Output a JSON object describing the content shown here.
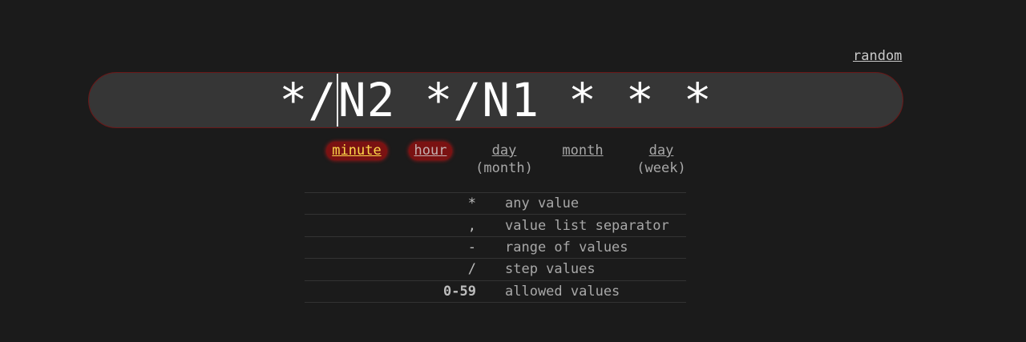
{
  "header": {
    "random_label": "random"
  },
  "cron": {
    "before_caret": "*/",
    "after_caret": "N2 */N1 * * *"
  },
  "fields": [
    {
      "name": "minute",
      "sub": "",
      "state": "active-primary"
    },
    {
      "name": "hour",
      "sub": "",
      "state": "active-secondary"
    },
    {
      "name": "day",
      "sub": "(month)",
      "state": "normal"
    },
    {
      "name": "month",
      "sub": "",
      "state": "normal"
    },
    {
      "name": "day",
      "sub": "(week)",
      "state": "normal"
    }
  ],
  "legend": [
    {
      "symbol": "*",
      "description": "any value"
    },
    {
      "symbol": ",",
      "description": "value list separator"
    },
    {
      "symbol": "-",
      "description": "range of values"
    },
    {
      "symbol": "/",
      "description": "step values"
    },
    {
      "symbol": "0-59",
      "description": "allowed values"
    }
  ],
  "colors": {
    "background": "#1b1b1b",
    "input_background": "#363636",
    "input_border": "#6a1818",
    "active_field_bg": "#7a1212",
    "active_field_text": "#ffd84a"
  }
}
